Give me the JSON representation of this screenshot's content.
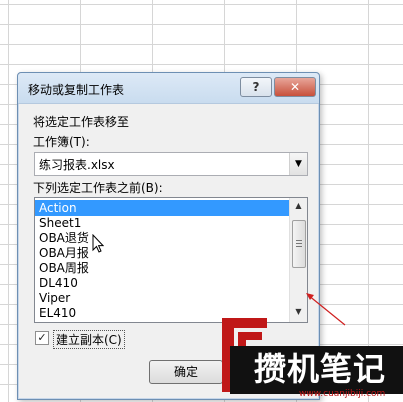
{
  "dialog": {
    "title": "移动或复制工作表",
    "help_label": "?",
    "close_label": "✕",
    "move_to_label": "将选定工作表移至",
    "workbook_label": "工作簿(T):",
    "workbook_value": "练习报表.xlsx",
    "before_sheet_label": "下列选定工作表之前(B):",
    "sheets": [
      "Action",
      "Sheet1",
      "OBA退货",
      "OBA月报",
      "OBA周报",
      "DL410",
      "Viper",
      "EL410"
    ],
    "selected_index": 0,
    "create_copy_label": "建立副本(C)",
    "create_copy_checked": true,
    "ok_label": "确定"
  },
  "watermark": {
    "brand": "攒机笔记",
    "url": "www.cuanjibiji.com"
  },
  "colors": {
    "selection": "#3399ff",
    "watermark_red": "#c01818"
  }
}
